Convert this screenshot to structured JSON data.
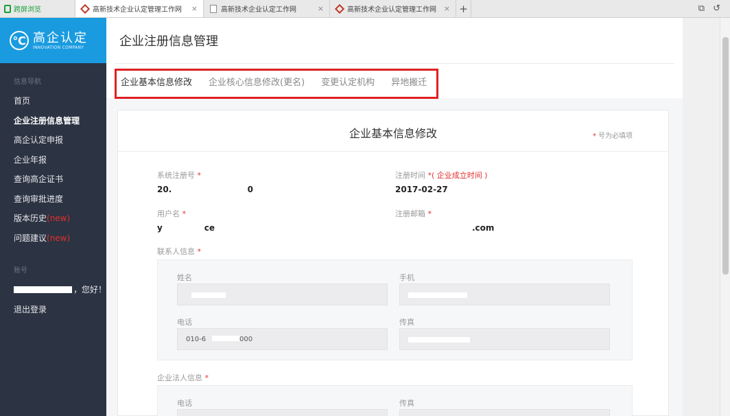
{
  "browser": {
    "mode_label": "跨屏浏览",
    "tabs": [
      {
        "label": "高新技术企业认定管理工作网",
        "close": "×"
      },
      {
        "label": "高新技术企业认定工作网",
        "close": "×"
      },
      {
        "label": "高新技术企业认定管理工作网",
        "close": "×"
      }
    ],
    "new_tab": "+",
    "restore_icon": "⧉",
    "undo_icon": "↺"
  },
  "logo": {
    "mark": "℃",
    "title": "高企认定",
    "subtitle": "INNOVATION COMPANY"
  },
  "sidebar": {
    "nav_group": "信息导航",
    "items": [
      {
        "label": "首页"
      },
      {
        "label": "企业注册信息管理"
      },
      {
        "label": "高企认定申报"
      },
      {
        "label": "企业年报"
      },
      {
        "label": "查询高企证书"
      },
      {
        "label": "查询审批进度"
      },
      {
        "label": "版本历史",
        "tag": "(new)"
      },
      {
        "label": "问题建议",
        "tag": "(new)"
      }
    ],
    "account_group": "账号",
    "greeting": "，您好！",
    "logout": "退出登录"
  },
  "main": {
    "page_title": "企业注册信息管理",
    "subtabs": [
      "企业基本信息修改",
      "企业核心信息修改(更名)",
      "变更认定机构",
      "异地搬迁"
    ],
    "card_title": "企业基本信息修改",
    "required_note": "号为必填项",
    "star": "*",
    "fields": {
      "reg_no_label": "系统注册号",
      "reg_no_value_a": "20.",
      "reg_no_value_b": "0",
      "reg_time_label": "注册时间",
      "reg_time_hint": "( 企业成立时间 )",
      "reg_time_value": "2017-02-27",
      "username_label": "用户名",
      "username_value_a": "y",
      "username_value_b": "ce",
      "email_label": "注册邮箱",
      "email_value": ".com"
    },
    "contact": {
      "section": "联系人信息",
      "name_label": "姓名",
      "phone_label": "手机",
      "tel_label": "电话",
      "fax_label": "传真",
      "tel_value": "010-6",
      "tel_value_tail": "000"
    },
    "legal": {
      "section": "企业法人信息",
      "tel_label": "电话",
      "fax_label": "传真"
    }
  }
}
